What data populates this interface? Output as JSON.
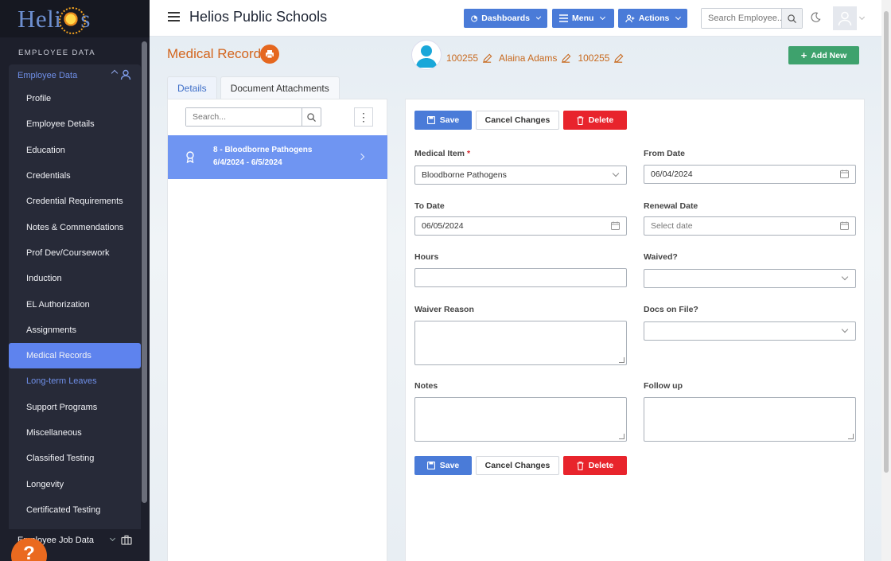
{
  "brand": {
    "logo_text_left": "Heli",
    "logo_text_right": "s"
  },
  "sidebar": {
    "section_label": "EMPLOYEE DATA",
    "group_label": "Employee Data",
    "items": [
      {
        "label": "Profile"
      },
      {
        "label": "Employee Details"
      },
      {
        "label": "Education"
      },
      {
        "label": "Credentials"
      },
      {
        "label": "Credential Requirements"
      },
      {
        "label": "Notes & Commendations"
      },
      {
        "label": "Prof Dev/Coursework"
      },
      {
        "label": "Induction"
      },
      {
        "label": "EL Authorization"
      },
      {
        "label": "Assignments"
      },
      {
        "label": "Medical Records"
      },
      {
        "label": "Long-term Leaves"
      },
      {
        "label": "Support Programs"
      },
      {
        "label": "Miscellaneous"
      },
      {
        "label": "Classified Testing"
      },
      {
        "label": "Longevity"
      },
      {
        "label": "Certificated Testing"
      }
    ],
    "footer_group_label": "Employee Job Data",
    "help_label": "?"
  },
  "topbar": {
    "title": "Helios Public Schools",
    "dashboards_label": "Dashboards",
    "menu_label": "Menu",
    "actions_label": "Actions",
    "search_placeholder": "Search Employee..."
  },
  "page": {
    "title": "Medical Records",
    "employee_id": "100255",
    "employee_name": "Alaina Adams",
    "employee_id_2": "100255",
    "add_new_label": "Add New",
    "tabs": [
      {
        "label": "Details"
      },
      {
        "label": "Document Attachments"
      }
    ]
  },
  "record_list": {
    "search_placeholder": "Search...",
    "kebab": "⋮",
    "items": [
      {
        "title": "8 - Bloodborne Pathogens",
        "dates": "6/4/2024 - 6/5/2024"
      }
    ]
  },
  "form": {
    "save_label": "Save",
    "cancel_label": "Cancel Changes",
    "delete_label": "Delete",
    "medical_item_label": "Medical Item",
    "required_mark": "*",
    "medical_item_value": "Bloodborne Pathogens",
    "from_date_label": "From Date",
    "from_date_value": "06/04/2024",
    "to_date_label": "To Date",
    "to_date_value": "06/05/2024",
    "renewal_date_label": "Renewal Date",
    "renewal_date_placeholder": "Select date",
    "hours_label": "Hours",
    "waived_label": "Waived?",
    "waiver_reason_label": "Waiver Reason",
    "docs_on_file_label": "Docs on File?",
    "notes_label": "Notes",
    "follow_up_label": "Follow up"
  },
  "colors": {
    "sidebar_bg": "#1d1f2b",
    "active_nav": "#5e83ee",
    "primary": "#4a7bd8",
    "danger": "#e8242c",
    "success": "#3ea26d",
    "accent_orange": "#d3651d"
  }
}
